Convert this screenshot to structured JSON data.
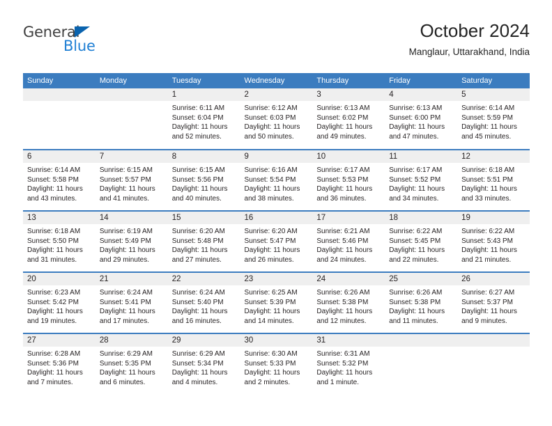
{
  "brand": {
    "name_part1": "General",
    "name_part2": "Blue",
    "triangle_icon": "triangle-icon",
    "colors": {
      "dark": "#3f3f3f",
      "blue": "#1f7fd4",
      "triangle": "#0a63ae"
    }
  },
  "header": {
    "title": "October 2024",
    "subtitle": "Manglaur, Uttarakhand, India"
  },
  "calendar": {
    "accent_color": "#3b7cbf",
    "daynum_band_color": "#efefef",
    "weekdays": [
      "Sunday",
      "Monday",
      "Tuesday",
      "Wednesday",
      "Thursday",
      "Friday",
      "Saturday"
    ],
    "weeks": [
      [
        {
          "day": "",
          "sunrise": "",
          "sunset": "",
          "daylight_line1": "",
          "daylight_line2": ""
        },
        {
          "day": "",
          "sunrise": "",
          "sunset": "",
          "daylight_line1": "",
          "daylight_line2": ""
        },
        {
          "day": "1",
          "sunrise": "Sunrise: 6:11 AM",
          "sunset": "Sunset: 6:04 PM",
          "daylight_line1": "Daylight: 11 hours",
          "daylight_line2": "and 52 minutes."
        },
        {
          "day": "2",
          "sunrise": "Sunrise: 6:12 AM",
          "sunset": "Sunset: 6:03 PM",
          "daylight_line1": "Daylight: 11 hours",
          "daylight_line2": "and 50 minutes."
        },
        {
          "day": "3",
          "sunrise": "Sunrise: 6:13 AM",
          "sunset": "Sunset: 6:02 PM",
          "daylight_line1": "Daylight: 11 hours",
          "daylight_line2": "and 49 minutes."
        },
        {
          "day": "4",
          "sunrise": "Sunrise: 6:13 AM",
          "sunset": "Sunset: 6:00 PM",
          "daylight_line1": "Daylight: 11 hours",
          "daylight_line2": "and 47 minutes."
        },
        {
          "day": "5",
          "sunrise": "Sunrise: 6:14 AM",
          "sunset": "Sunset: 5:59 PM",
          "daylight_line1": "Daylight: 11 hours",
          "daylight_line2": "and 45 minutes."
        }
      ],
      [
        {
          "day": "6",
          "sunrise": "Sunrise: 6:14 AM",
          "sunset": "Sunset: 5:58 PM",
          "daylight_line1": "Daylight: 11 hours",
          "daylight_line2": "and 43 minutes."
        },
        {
          "day": "7",
          "sunrise": "Sunrise: 6:15 AM",
          "sunset": "Sunset: 5:57 PM",
          "daylight_line1": "Daylight: 11 hours",
          "daylight_line2": "and 41 minutes."
        },
        {
          "day": "8",
          "sunrise": "Sunrise: 6:15 AM",
          "sunset": "Sunset: 5:56 PM",
          "daylight_line1": "Daylight: 11 hours",
          "daylight_line2": "and 40 minutes."
        },
        {
          "day": "9",
          "sunrise": "Sunrise: 6:16 AM",
          "sunset": "Sunset: 5:54 PM",
          "daylight_line1": "Daylight: 11 hours",
          "daylight_line2": "and 38 minutes."
        },
        {
          "day": "10",
          "sunrise": "Sunrise: 6:17 AM",
          "sunset": "Sunset: 5:53 PM",
          "daylight_line1": "Daylight: 11 hours",
          "daylight_line2": "and 36 minutes."
        },
        {
          "day": "11",
          "sunrise": "Sunrise: 6:17 AM",
          "sunset": "Sunset: 5:52 PM",
          "daylight_line1": "Daylight: 11 hours",
          "daylight_line2": "and 34 minutes."
        },
        {
          "day": "12",
          "sunrise": "Sunrise: 6:18 AM",
          "sunset": "Sunset: 5:51 PM",
          "daylight_line1": "Daylight: 11 hours",
          "daylight_line2": "and 33 minutes."
        }
      ],
      [
        {
          "day": "13",
          "sunrise": "Sunrise: 6:18 AM",
          "sunset": "Sunset: 5:50 PM",
          "daylight_line1": "Daylight: 11 hours",
          "daylight_line2": "and 31 minutes."
        },
        {
          "day": "14",
          "sunrise": "Sunrise: 6:19 AM",
          "sunset": "Sunset: 5:49 PM",
          "daylight_line1": "Daylight: 11 hours",
          "daylight_line2": "and 29 minutes."
        },
        {
          "day": "15",
          "sunrise": "Sunrise: 6:20 AM",
          "sunset": "Sunset: 5:48 PM",
          "daylight_line1": "Daylight: 11 hours",
          "daylight_line2": "and 27 minutes."
        },
        {
          "day": "16",
          "sunrise": "Sunrise: 6:20 AM",
          "sunset": "Sunset: 5:47 PM",
          "daylight_line1": "Daylight: 11 hours",
          "daylight_line2": "and 26 minutes."
        },
        {
          "day": "17",
          "sunrise": "Sunrise: 6:21 AM",
          "sunset": "Sunset: 5:46 PM",
          "daylight_line1": "Daylight: 11 hours",
          "daylight_line2": "and 24 minutes."
        },
        {
          "day": "18",
          "sunrise": "Sunrise: 6:22 AM",
          "sunset": "Sunset: 5:45 PM",
          "daylight_line1": "Daylight: 11 hours",
          "daylight_line2": "and 22 minutes."
        },
        {
          "day": "19",
          "sunrise": "Sunrise: 6:22 AM",
          "sunset": "Sunset: 5:43 PM",
          "daylight_line1": "Daylight: 11 hours",
          "daylight_line2": "and 21 minutes."
        }
      ],
      [
        {
          "day": "20",
          "sunrise": "Sunrise: 6:23 AM",
          "sunset": "Sunset: 5:42 PM",
          "daylight_line1": "Daylight: 11 hours",
          "daylight_line2": "and 19 minutes."
        },
        {
          "day": "21",
          "sunrise": "Sunrise: 6:24 AM",
          "sunset": "Sunset: 5:41 PM",
          "daylight_line1": "Daylight: 11 hours",
          "daylight_line2": "and 17 minutes."
        },
        {
          "day": "22",
          "sunrise": "Sunrise: 6:24 AM",
          "sunset": "Sunset: 5:40 PM",
          "daylight_line1": "Daylight: 11 hours",
          "daylight_line2": "and 16 minutes."
        },
        {
          "day": "23",
          "sunrise": "Sunrise: 6:25 AM",
          "sunset": "Sunset: 5:39 PM",
          "daylight_line1": "Daylight: 11 hours",
          "daylight_line2": "and 14 minutes."
        },
        {
          "day": "24",
          "sunrise": "Sunrise: 6:26 AM",
          "sunset": "Sunset: 5:38 PM",
          "daylight_line1": "Daylight: 11 hours",
          "daylight_line2": "and 12 minutes."
        },
        {
          "day": "25",
          "sunrise": "Sunrise: 6:26 AM",
          "sunset": "Sunset: 5:38 PM",
          "daylight_line1": "Daylight: 11 hours",
          "daylight_line2": "and 11 minutes."
        },
        {
          "day": "26",
          "sunrise": "Sunrise: 6:27 AM",
          "sunset": "Sunset: 5:37 PM",
          "daylight_line1": "Daylight: 11 hours",
          "daylight_line2": "and 9 minutes."
        }
      ],
      [
        {
          "day": "27",
          "sunrise": "Sunrise: 6:28 AM",
          "sunset": "Sunset: 5:36 PM",
          "daylight_line1": "Daylight: 11 hours",
          "daylight_line2": "and 7 minutes."
        },
        {
          "day": "28",
          "sunrise": "Sunrise: 6:29 AM",
          "sunset": "Sunset: 5:35 PM",
          "daylight_line1": "Daylight: 11 hours",
          "daylight_line2": "and 6 minutes."
        },
        {
          "day": "29",
          "sunrise": "Sunrise: 6:29 AM",
          "sunset": "Sunset: 5:34 PM",
          "daylight_line1": "Daylight: 11 hours",
          "daylight_line2": "and 4 minutes."
        },
        {
          "day": "30",
          "sunrise": "Sunrise: 6:30 AM",
          "sunset": "Sunset: 5:33 PM",
          "daylight_line1": "Daylight: 11 hours",
          "daylight_line2": "and 2 minutes."
        },
        {
          "day": "31",
          "sunrise": "Sunrise: 6:31 AM",
          "sunset": "Sunset: 5:32 PM",
          "daylight_line1": "Daylight: 11 hours",
          "daylight_line2": "and 1 minute."
        },
        {
          "day": "",
          "sunrise": "",
          "sunset": "",
          "daylight_line1": "",
          "daylight_line2": ""
        },
        {
          "day": "",
          "sunrise": "",
          "sunset": "",
          "daylight_line1": "",
          "daylight_line2": ""
        }
      ]
    ]
  }
}
